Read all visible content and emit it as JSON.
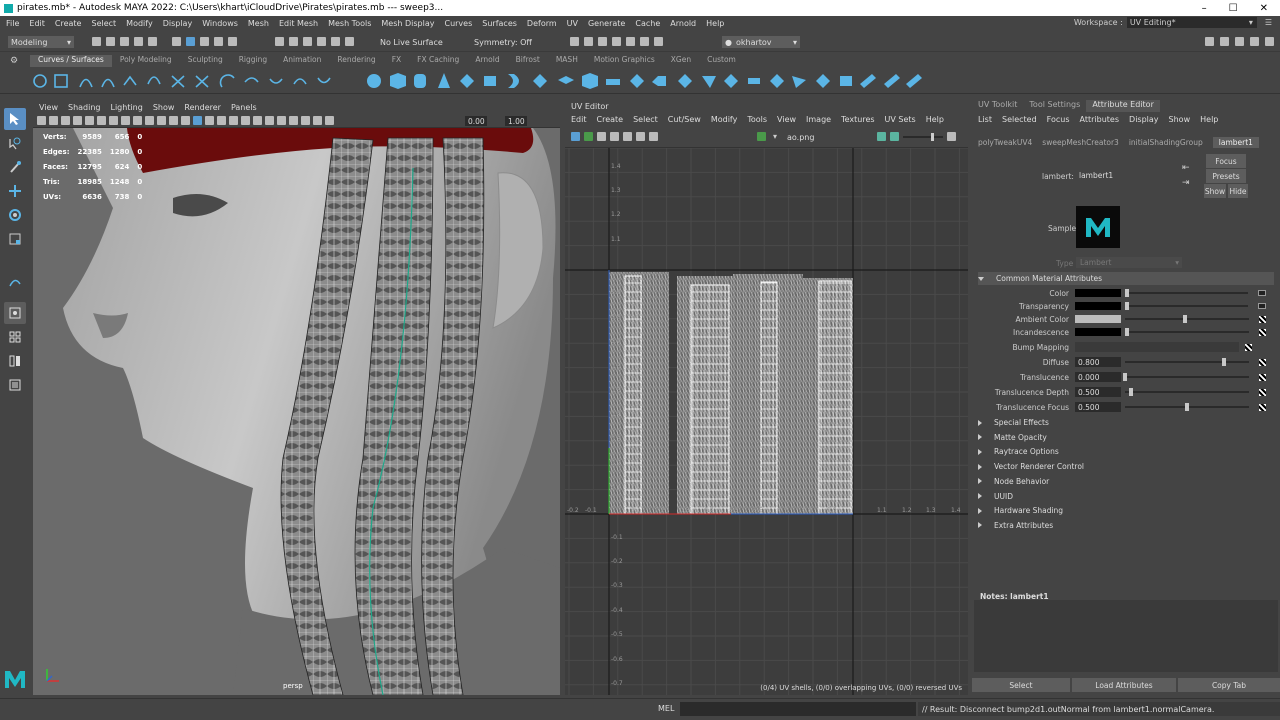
{
  "titlebar": {
    "title": "pirates.mb* - Autodesk MAYA 2022: C:\\Users\\khart\\iCloudDrive\\Pirates\\pirates.mb   ---   sweep3..."
  },
  "menubar": [
    "File",
    "Edit",
    "Create",
    "Select",
    "Modify",
    "Display",
    "Windows",
    "Mesh",
    "Edit Mesh",
    "Mesh Tools",
    "Mesh Display",
    "Curves",
    "Surfaces",
    "Deform",
    "UV",
    "Generate",
    "Cache",
    "Arnold",
    "Help"
  ],
  "workspace": {
    "label": "Workspace :",
    "value": "UV Editing*"
  },
  "statusline": {
    "mode": "Modeling",
    "live_surface": "No Live Surface",
    "symmetry": "Symmetry: Off",
    "user": "okhartov"
  },
  "shelf_tabs": [
    "Curves / Surfaces",
    "Poly Modeling",
    "Sculpting",
    "Rigging",
    "Animation",
    "Rendering",
    "FX",
    "FX Caching",
    "Arnold",
    "Bifrost",
    "MASH",
    "Motion Graphics",
    "XGen",
    "Custom"
  ],
  "viewport": {
    "menu": [
      "View",
      "Shading",
      "Lighting",
      "Show",
      "Renderer",
      "Panels"
    ],
    "field_a": "0.00",
    "field_b": "1.00",
    "hud": [
      {
        "label": "Verts:",
        "a": "9589",
        "b": "656",
        "c": "0"
      },
      {
        "label": "Edges:",
        "a": "22385",
        "b": "1280",
        "c": "0"
      },
      {
        "label": "Faces:",
        "a": "12795",
        "b": "624",
        "c": "0"
      },
      {
        "label": "Tris:",
        "a": "18985",
        "b": "1248",
        "c": "0"
      },
      {
        "label": "UVs:",
        "a": "6636",
        "b": "738",
        "c": "0"
      }
    ],
    "camera": "persp"
  },
  "uv_editor": {
    "title": "UV Editor",
    "menu": [
      "Edit",
      "Create",
      "Select",
      "Cut/Sew",
      "Modify",
      "Tools",
      "View",
      "Image",
      "Textures",
      "UV Sets",
      "Help"
    ],
    "image_name": "ao.png",
    "v_ticks": [
      "1.4",
      "1.3",
      "1.2",
      "1.1",
      "0.9",
      "0.8",
      "0.7",
      "0.6",
      "0.5",
      "0.4",
      "0.3",
      "0.2",
      "0.1",
      "-0.1",
      "-0.2",
      "-0.3",
      "-0.4",
      "-0.5",
      "-0.6",
      "-0.7"
    ],
    "u_ticks": [
      "-0.2",
      "-0.1",
      "0.1",
      "0.2",
      "0.3",
      "0.4",
      "0.5",
      "0.6",
      "0.7",
      "0.8",
      "0.9",
      "1.1",
      "1.2",
      "1.3",
      "1.4"
    ],
    "status": "(0/4) UV shells, (0/0) overlapping UVs, (0/0) reversed UVs"
  },
  "attribute_editor": {
    "tabs": [
      "UV Toolkit",
      "Tool Settings",
      "Attribute Editor"
    ],
    "menu": [
      "List",
      "Selected",
      "Focus",
      "Attributes",
      "Display",
      "Show",
      "Help"
    ],
    "nodes": [
      "polyTweakUV4",
      "sweepMeshCreator3",
      "initialShadingGroup",
      "lambert1"
    ],
    "focus": "Focus",
    "presets": "Presets",
    "show": "Show",
    "hide": "Hide",
    "node_label": "lambert:",
    "node_name": "lambert1",
    "sample_label": "Sample",
    "type_label": "Type",
    "type_value": "Lambert",
    "section_open": "Common Material Attributes",
    "attrs": {
      "color": {
        "label": "Color"
      },
      "transparency": {
        "label": "Transparency"
      },
      "ambient": {
        "label": "Ambient Color"
      },
      "incandescence": {
        "label": "Incandescence"
      },
      "bump": {
        "label": "Bump Mapping"
      },
      "diffuse": {
        "label": "Diffuse",
        "value": "0.800",
        "level": 0.8
      },
      "translucence": {
        "label": "Translucence",
        "value": "0.000",
        "level": 0.0
      },
      "trans_depth": {
        "label": "Translucence Depth",
        "value": "0.500",
        "level": 0.05
      },
      "trans_focus": {
        "label": "Translucence Focus",
        "value": "0.500",
        "level": 0.5
      }
    },
    "sections": [
      "Special Effects",
      "Matte Opacity",
      "Raytrace Options",
      "Vector Renderer Control",
      "Node Behavior",
      "UUID",
      "Hardware Shading",
      "Extra Attributes"
    ],
    "notes_label": "Notes:  lambert1",
    "buttons": {
      "select": "Select",
      "load": "Load Attributes",
      "copy": "Copy Tab"
    }
  },
  "bottom": {
    "mel": "MEL",
    "result": "// Result: Disconnect bump2d1.outNormal from lambert1.normalCamera."
  }
}
